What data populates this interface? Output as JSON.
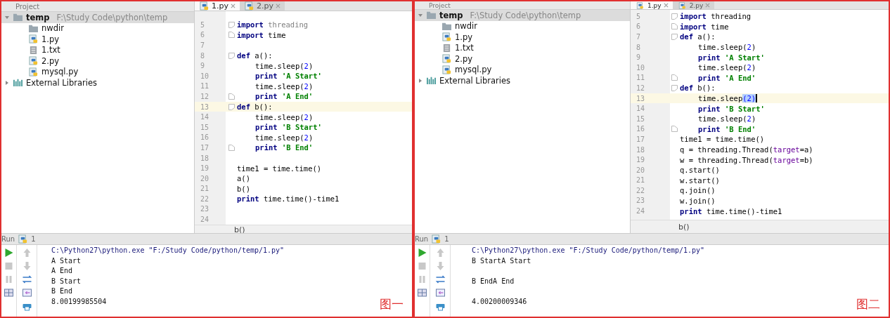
{
  "panels": [
    {
      "project_header": "Project",
      "tabs": [
        {
          "label": "1.py",
          "selected": true
        },
        {
          "label": "2.py",
          "selected": false
        }
      ],
      "tree": [
        {
          "label": "temp",
          "path": "F:\\Study Code\\python\\temp",
          "kind": "folder",
          "expanded": true,
          "selected": true,
          "children": [
            {
              "label": "nwdir",
              "kind": "folder",
              "selected": false
            },
            {
              "label": "1.py",
              "kind": "python",
              "selected": false
            },
            {
              "label": "1.txt",
              "kind": "text",
              "selected": false
            },
            {
              "label": "2.py",
              "kind": "python",
              "selected": false
            },
            {
              "label": "mysql.py",
              "kind": "python",
              "selected": false
            }
          ]
        },
        {
          "label": "External Libraries",
          "kind": "library",
          "expanded": false,
          "selected": false
        }
      ],
      "lines": [
        {
          "number": "5",
          "highlighted": false,
          "fold_open": true,
          "tokens": [
            {
              "text": "import",
              "kind": "kw"
            },
            {
              "text": " threading",
              "kind": "unused"
            }
          ]
        },
        {
          "number": "6",
          "highlighted": false,
          "fold_close": true,
          "tokens": [
            {
              "text": "import",
              "kind": "kw"
            },
            {
              "text": " time",
              "kind": "plain"
            }
          ]
        },
        {
          "number": "7",
          "highlighted": false
        },
        {
          "number": "8",
          "highlighted": false,
          "fold_open": true,
          "tokens": [
            {
              "text": "def",
              "kind": "kw"
            },
            {
              "text": " a():",
              "kind": "plain"
            }
          ],
          "children": [
            {
              "number": "9",
              "highlighted": false,
              "tokens": [
                {
                  "text": "time.sleep(",
                  "kind": "plain"
                },
                {
                  "text": "2",
                  "kind": "num"
                },
                {
                  "text": ")",
                  "kind": "plain"
                }
              ]
            },
            {
              "number": "10",
              "highlighted": false,
              "tokens": [
                {
                  "text": "print",
                  "kind": "kw"
                },
                {
                  "text": " 'A Start'",
                  "kind": "str"
                }
              ]
            },
            {
              "number": "11",
              "highlighted": false,
              "tokens": [
                {
                  "text": "time.sleep(",
                  "kind": "plain"
                },
                {
                  "text": "2",
                  "kind": "num"
                },
                {
                  "text": ")",
                  "kind": "plain"
                }
              ]
            },
            {
              "number": "12",
              "highlighted": false,
              "fold_close": true,
              "tokens": [
                {
                  "text": "print",
                  "kind": "kw"
                },
                {
                  "text": " 'A End'",
                  "kind": "str"
                }
              ]
            }
          ]
        },
        {
          "number": "13",
          "highlighted": true,
          "fold_open": true,
          "tokens": [
            {
              "text": "def",
              "kind": "kw"
            },
            {
              "text": " b():",
              "kind": "plain"
            }
          ],
          "children": [
            {
              "number": "14",
              "highlighted": false,
              "tokens": [
                {
                  "text": "time.sleep(",
                  "kind": "plain"
                },
                {
                  "text": "2",
                  "kind": "num"
                },
                {
                  "text": ")",
                  "kind": "plain"
                }
              ]
            },
            {
              "number": "15",
              "highlighted": false,
              "tokens": [
                {
                  "text": "print",
                  "kind": "kw"
                },
                {
                  "text": " 'B Start'",
                  "kind": "str"
                }
              ]
            },
            {
              "number": "16",
              "highlighted": false,
              "tokens": [
                {
                  "text": "time.sleep(",
                  "kind": "plain"
                },
                {
                  "text": "2",
                  "kind": "num"
                },
                {
                  "text": ")",
                  "kind": "plain"
                }
              ]
            },
            {
              "number": "17",
              "highlighted": false,
              "fold_close": true,
              "tokens": [
                {
                  "text": "print",
                  "kind": "kw"
                },
                {
                  "text": " 'B End'",
                  "kind": "str"
                }
              ]
            }
          ]
        },
        {
          "number": "18",
          "highlighted": false
        },
        {
          "number": "19",
          "highlighted": false,
          "tokens": [
            {
              "text": "time1 = time.time()",
              "kind": "plain"
            }
          ]
        },
        {
          "number": "20",
          "highlighted": false,
          "tokens": [
            {
              "text": "a()",
              "kind": "plain"
            }
          ]
        },
        {
          "number": "21",
          "highlighted": false,
          "tokens": [
            {
              "text": "b()",
              "kind": "plain"
            }
          ]
        },
        {
          "number": "22",
          "highlighted": false,
          "tokens": [
            {
              "text": "print",
              "kind": "kw"
            },
            {
              "text": " time.time()-time1",
              "kind": "plain"
            }
          ]
        },
        {
          "number": "23",
          "highlighted": false
        },
        {
          "number": "24",
          "highlighted": false
        }
      ],
      "breadcrumb": "b()",
      "run_label": "Run",
      "run_tab": "1",
      "console": [
        {
          "text": "C:\\Python27\\python.exe \"F:/Study Code/python/temp/1.py\"",
          "kind": "command",
          "gap_before": false
        },
        {
          "text": "A Start",
          "kind": "output",
          "gap_before": false
        },
        {
          "text": "A End",
          "kind": "output",
          "gap_before": false
        },
        {
          "text": "B Start",
          "kind": "output",
          "gap_before": false
        },
        {
          "text": "B End",
          "kind": "output",
          "gap_before": false
        },
        {
          "text": "8.00199985504",
          "kind": "output",
          "gap_before": false
        }
      ],
      "caption": "图一"
    },
    {
      "project_header": "Project",
      "tabs": [
        {
          "label": "1.py",
          "selected": true
        },
        {
          "label": "2.py",
          "selected": false
        }
      ],
      "tree": [
        {
          "label": "temp",
          "path": "F:\\Study Code\\python\\temp",
          "kind": "folder",
          "expanded": true,
          "selected": true,
          "children": [
            {
              "label": "nwdir",
              "kind": "folder",
              "selected": false
            },
            {
              "label": "1.py",
              "kind": "python",
              "selected": false
            },
            {
              "label": "1.txt",
              "kind": "text",
              "selected": false
            },
            {
              "label": "2.py",
              "kind": "python",
              "selected": false
            },
            {
              "label": "mysql.py",
              "kind": "python",
              "selected": false
            }
          ]
        },
        {
          "label": "External Libraries",
          "kind": "library",
          "expanded": false,
          "selected": false
        }
      ],
      "lines": [
        {
          "number": "5",
          "highlighted": false,
          "fold_open": true,
          "tokens": [
            {
              "text": "import",
              "kind": "kw"
            },
            {
              "text": " threading",
              "kind": "plain"
            }
          ]
        },
        {
          "number": "6",
          "highlighted": false,
          "fold_close": true,
          "tokens": [
            {
              "text": "import",
              "kind": "kw"
            },
            {
              "text": " time",
              "kind": "plain"
            }
          ]
        },
        {
          "number": "7",
          "highlighted": false,
          "fold_open": true,
          "tokens": [
            {
              "text": "def",
              "kind": "kw"
            },
            {
              "text": " a():",
              "kind": "plain"
            }
          ],
          "children": [
            {
              "number": "8",
              "highlighted": false,
              "tokens": [
                {
                  "text": "time.sleep(",
                  "kind": "plain"
                },
                {
                  "text": "2",
                  "kind": "num"
                },
                {
                  "text": ")",
                  "kind": "plain"
                }
              ]
            },
            {
              "number": "9",
              "highlighted": false,
              "tokens": [
                {
                  "text": "print",
                  "kind": "kw"
                },
                {
                  "text": " 'A Start'",
                  "kind": "str"
                }
              ]
            },
            {
              "number": "10",
              "highlighted": false,
              "tokens": [
                {
                  "text": "time.sleep(",
                  "kind": "plain"
                },
                {
                  "text": "2",
                  "kind": "num"
                },
                {
                  "text": ")",
                  "kind": "plain"
                }
              ]
            },
            {
              "number": "11",
              "highlighted": false,
              "fold_close": true,
              "tokens": [
                {
                  "text": "print",
                  "kind": "kw"
                },
                {
                  "text": " 'A End'",
                  "kind": "str"
                }
              ]
            }
          ]
        },
        {
          "number": "12",
          "highlighted": false,
          "fold_open": true,
          "tokens": [
            {
              "text": "def",
              "kind": "kw"
            },
            {
              "text": " b():",
              "kind": "plain"
            }
          ],
          "children": [
            {
              "number": "13",
              "highlighted": true,
              "tokens": [
                {
                  "text": "time.sleep",
                  "kind": "plain"
                },
                {
                  "text": "(2)",
                  "kind": "matched"
                }
              ]
            },
            {
              "number": "14",
              "highlighted": false,
              "tokens": [
                {
                  "text": "print",
                  "kind": "kw"
                },
                {
                  "text": " 'B Start'",
                  "kind": "str"
                }
              ]
            },
            {
              "number": "15",
              "highlighted": false,
              "tokens": [
                {
                  "text": "time.sleep(",
                  "kind": "plain"
                },
                {
                  "text": "2",
                  "kind": "num"
                },
                {
                  "text": ")",
                  "kind": "plain"
                }
              ]
            },
            {
              "number": "16",
              "highlighted": false,
              "fold_close": true,
              "tokens": [
                {
                  "text": "print",
                  "kind": "kw"
                },
                {
                  "text": " 'B End'",
                  "kind": "str"
                }
              ]
            }
          ]
        },
        {
          "number": "17",
          "highlighted": false,
          "tokens": [
            {
              "text": "time1 = time.time()",
              "kind": "plain"
            }
          ]
        },
        {
          "number": "18",
          "highlighted": false,
          "tokens": [
            {
              "text": "q = threading.Thread(",
              "kind": "plain"
            },
            {
              "text": "target",
              "kind": "kwarg"
            },
            {
              "text": "=a)",
              "kind": "plain"
            }
          ]
        },
        {
          "number": "19",
          "highlighted": false,
          "tokens": [
            {
              "text": "w = threading.Thread(",
              "kind": "plain"
            },
            {
              "text": "target",
              "kind": "kwarg"
            },
            {
              "text": "=b)",
              "kind": "plain"
            }
          ]
        },
        {
          "number": "20",
          "highlighted": false,
          "tokens": [
            {
              "text": "q.start()",
              "kind": "plain"
            }
          ]
        },
        {
          "number": "21",
          "highlighted": false,
          "tokens": [
            {
              "text": "w.start()",
              "kind": "plain"
            }
          ]
        },
        {
          "number": "22",
          "highlighted": false,
          "tokens": [
            {
              "text": "q.join()",
              "kind": "plain"
            }
          ]
        },
        {
          "number": "23",
          "highlighted": false,
          "tokens": [
            {
              "text": "w.join()",
              "kind": "plain"
            }
          ]
        },
        {
          "number": "24",
          "highlighted": false,
          "tokens": [
            {
              "text": "print",
              "kind": "kw"
            },
            {
              "text": " time.time()-time1",
              "kind": "plain"
            }
          ]
        }
      ],
      "breadcrumb": "b()",
      "run_label": "Run",
      "run_tab": "1",
      "console": [
        {
          "text": "C:\\Python27\\python.exe \"F:/Study Code/python/temp/1.py\"",
          "kind": "command",
          "gap_before": false
        },
        {
          "text": "B StartA Start",
          "kind": "output",
          "gap_before": false
        },
        {
          "text": "B EndA End",
          "kind": "output",
          "gap_before": true
        },
        {
          "text": "4.00200009346",
          "kind": "output",
          "gap_before": true
        }
      ],
      "caption": "图二"
    }
  ]
}
